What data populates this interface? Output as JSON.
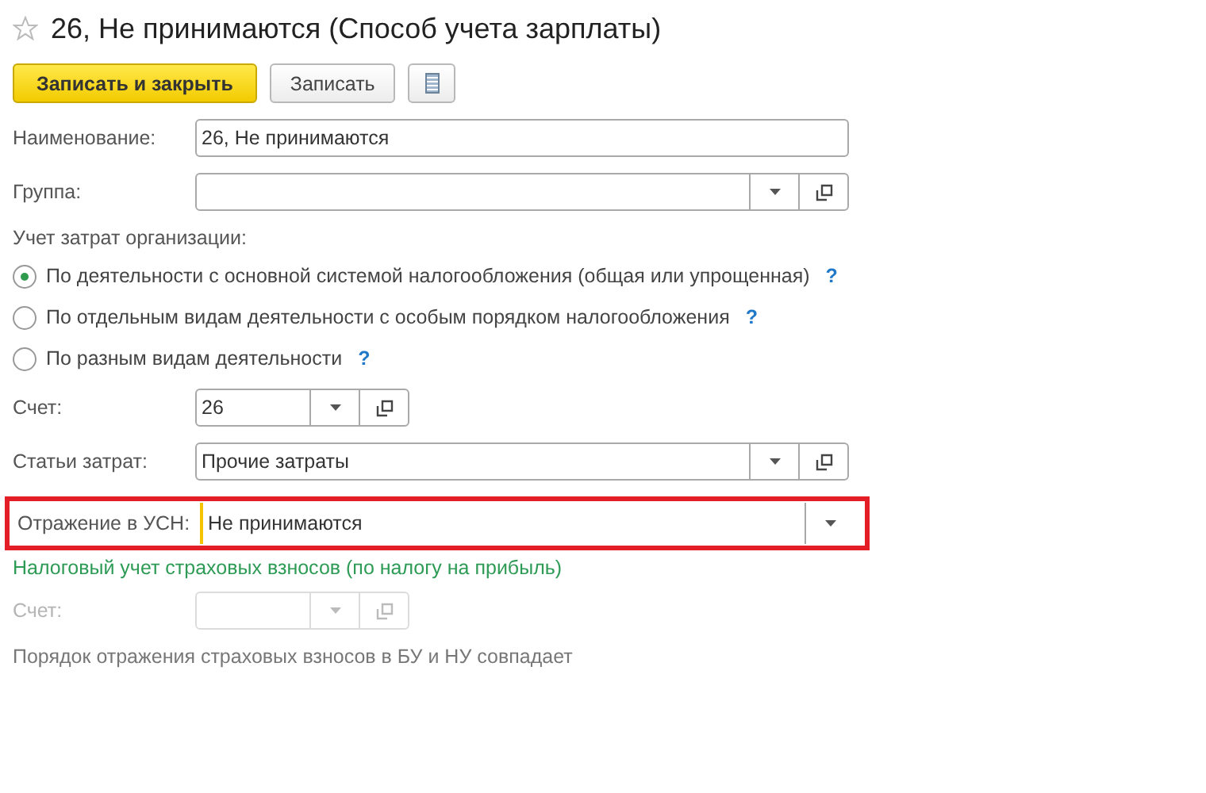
{
  "window": {
    "title": "26, Не принимаются (Способ учета зарплаты)",
    "favorite": false
  },
  "toolbar": {
    "primary_button": "Записать и закрыть",
    "secondary_button": "Записать"
  },
  "fields_top": [
    {
      "kind": "text",
      "label": "Наименование:",
      "value": "26, Не принимаются",
      "disabled": false,
      "highlighted": false
    },
    {
      "kind": "select",
      "label": "Группа:",
      "disabled": false,
      "highlighted": false
    }
  ],
  "cost_accounting": {
    "label": "Учет затрат организации:",
    "options": [
      {
        "label": "По деятельности с основной системой налогообложения (общая или упрощенная)",
        "help": "?",
        "selected": true
      },
      {
        "label": "По отдельным видам деятельности с особым порядком налогообложения",
        "help": "?",
        "selected": false
      },
      {
        "label": "По разным видам деятельности",
        "help": "?",
        "selected": false
      }
    ]
  },
  "fields_middle": [
    {
      "kind": "account",
      "label": "Счет:",
      "value": "26",
      "disabled": false,
      "highlighted": false
    },
    {
      "kind": "select",
      "label": "Статьи затрат:",
      "value": "Прочие затраты",
      "disabled": false,
      "highlighted": false
    },
    {
      "kind": "dropdown",
      "label": "Отражение в УСН:",
      "value": "Не принимаются",
      "disabled": false,
      "highlighted": true
    }
  ],
  "insurance_section": {
    "title": "Налоговый учет страховых взносов (по налогу на прибыль)",
    "fields": [
      {
        "kind": "account",
        "label": "Счет:",
        "disabled": true,
        "highlighted": false
      }
    ],
    "note": "Порядок отражения страховых взносов в БУ и НУ совпадает"
  }
}
